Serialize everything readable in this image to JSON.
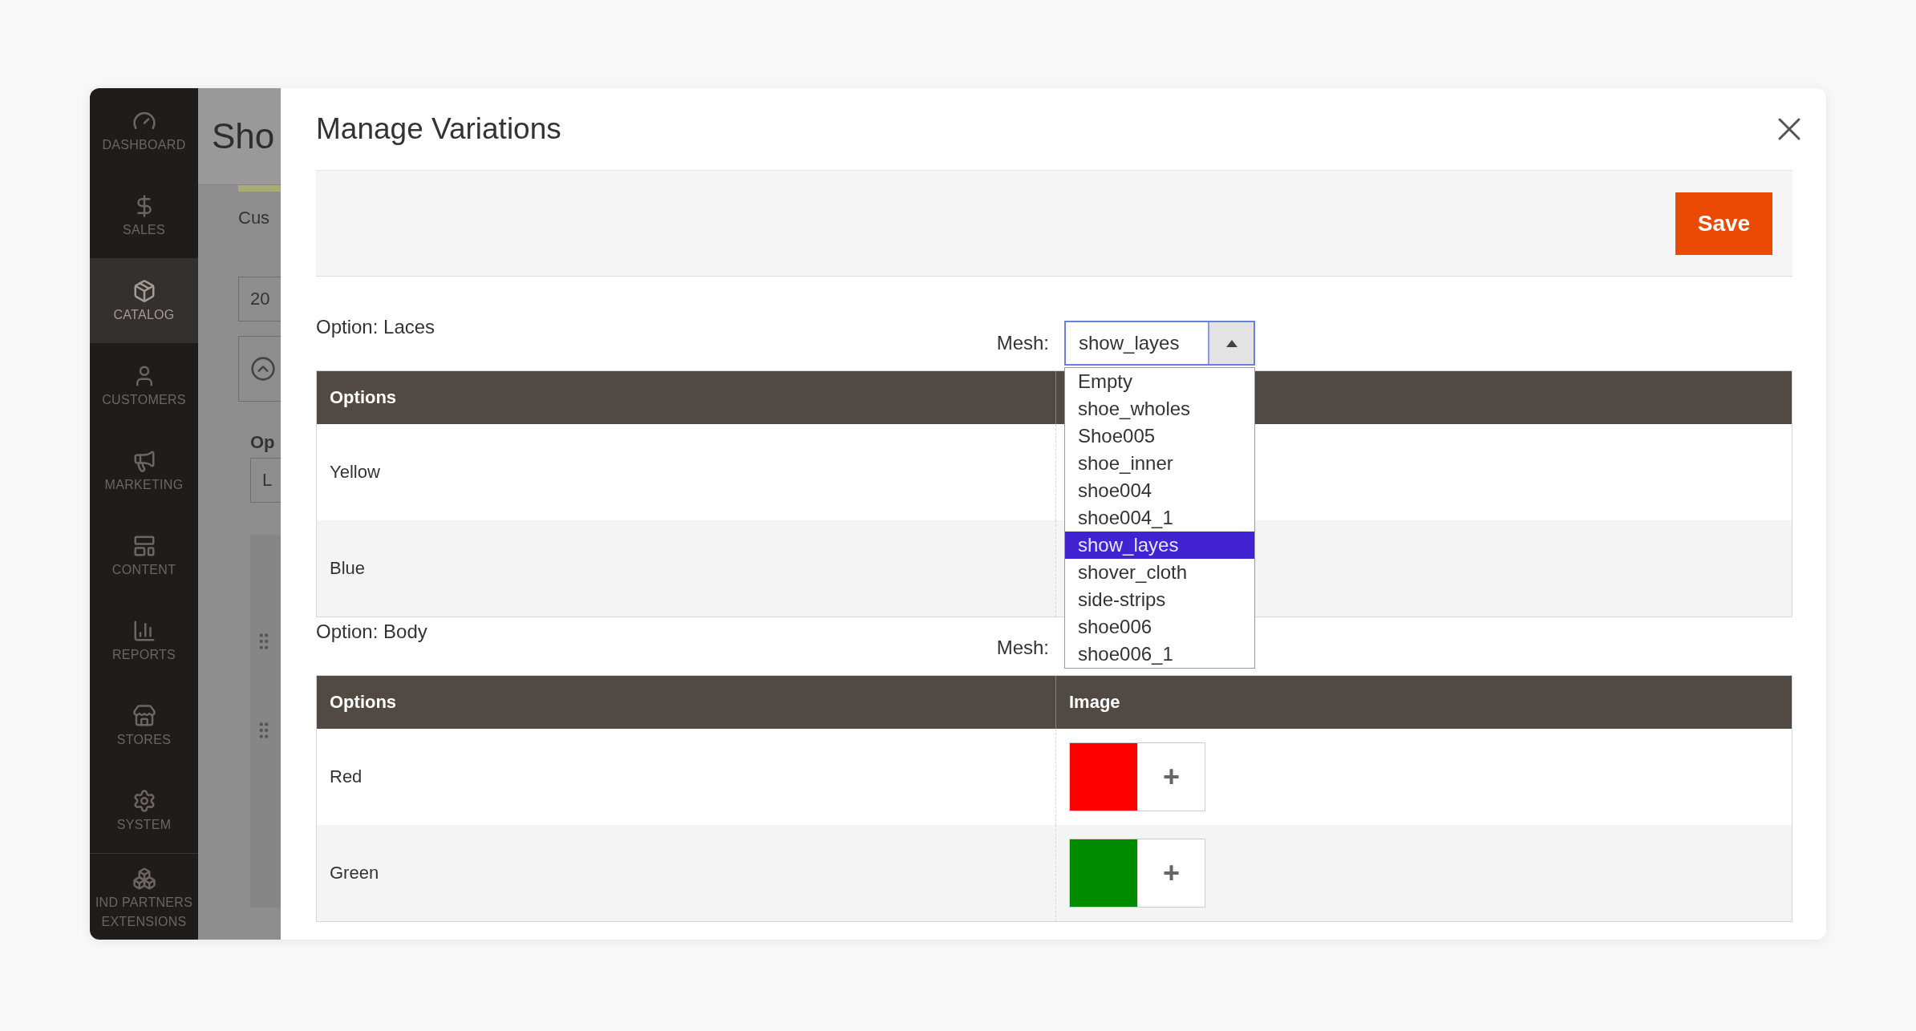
{
  "sidebar": {
    "items": [
      {
        "label": "DASHBOARD",
        "selected": false
      },
      {
        "label": "SALES",
        "selected": false
      },
      {
        "label": "CATALOG",
        "selected": true
      },
      {
        "label": "CUSTOMERS",
        "selected": false
      },
      {
        "label": "MARKETING",
        "selected": false
      },
      {
        "label": "CONTENT",
        "selected": false
      },
      {
        "label": "REPORTS",
        "selected": false
      },
      {
        "label": "STORES",
        "selected": false
      },
      {
        "label": "SYSTEM",
        "selected": false
      },
      {
        "label": "IND PARTNERS",
        "label_2": "EXTENSIONS",
        "selected": false
      }
    ]
  },
  "background_page": {
    "title": "Sho",
    "tab": "Cus",
    "field_1": "20",
    "heading": "Op",
    "field_2": "L"
  },
  "modal": {
    "title": "Manage Variations",
    "save_button": "Save",
    "sections": [
      {
        "label": "Option: Laces",
        "mesh_label": "Mesh:",
        "mesh": {
          "value": "show_layes",
          "expanded": true,
          "options": [
            {
              "label": "Empty",
              "selected": false
            },
            {
              "label": "shoe_wholes",
              "selected": false
            },
            {
              "label": "Shoe005",
              "selected": false
            },
            {
              "label": "shoe_inner",
              "selected": false
            },
            {
              "label": "shoe004",
              "selected": false
            },
            {
              "label": "shoe004_1",
              "selected": false
            },
            {
              "label": "show_layes",
              "selected": true
            },
            {
              "label": "shover_cloth",
              "selected": false
            },
            {
              "label": "side-strips",
              "selected": false
            },
            {
              "label": "shoe006",
              "selected": false
            },
            {
              "label": "shoe006_1",
              "selected": false
            }
          ]
        },
        "table": {
          "columns": [
            "Options"
          ],
          "rows": [
            {
              "option": "Yellow"
            },
            {
              "option": "Blue"
            }
          ]
        }
      },
      {
        "label": "Option: Body",
        "mesh_label": "Mesh:",
        "table": {
          "columns": [
            "Options",
            "Image"
          ],
          "rows": [
            {
              "option": "Red",
              "color": "#ff0000",
              "add_button": "+"
            },
            {
              "option": "Green",
              "color": "#008a00",
              "add_button": "+"
            }
          ]
        }
      }
    ]
  }
}
